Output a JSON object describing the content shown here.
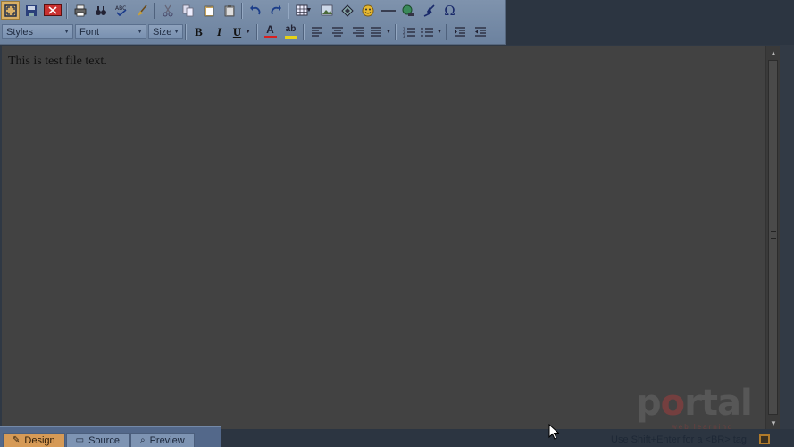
{
  "toolbar": {
    "row1_icons": [
      "fullscreen-icon",
      "save-icon",
      "cancel-icon",
      "print-icon",
      "find-icon",
      "spellcheck-icon",
      "clean-icon",
      "cut-icon",
      "copy-icon",
      "paste-icon",
      "paste-word-icon",
      "undo-icon",
      "redo-icon",
      "table-icon",
      "image-icon",
      "anchor-icon",
      "emoticon-icon",
      "horizontal-rule-icon",
      "hyperlink-icon",
      "flash-icon",
      "special-char-icon"
    ],
    "styles_label": "Styles",
    "font_label": "Font",
    "size_label": "Size",
    "bold": "B",
    "italic": "I",
    "underline": "U",
    "special_char": "Ω",
    "highlight_text": "ab",
    "font_color_text": "A",
    "colors": {
      "font_color": "#d81f1f",
      "highlight": "#e6d218",
      "active_button": "#d8b066"
    }
  },
  "editor": {
    "content": "This is test file text."
  },
  "footer": {
    "tabs": [
      {
        "label": "Design",
        "active": true
      },
      {
        "label": "Source",
        "active": false
      },
      {
        "label": "Preview",
        "active": false
      }
    ],
    "hint": "Use Shift+Enter for a <BR> tag"
  },
  "watermark": {
    "text_prefix": "p",
    "text_o": "o",
    "text_suffix": "rtal",
    "subtitle": "web learning"
  }
}
